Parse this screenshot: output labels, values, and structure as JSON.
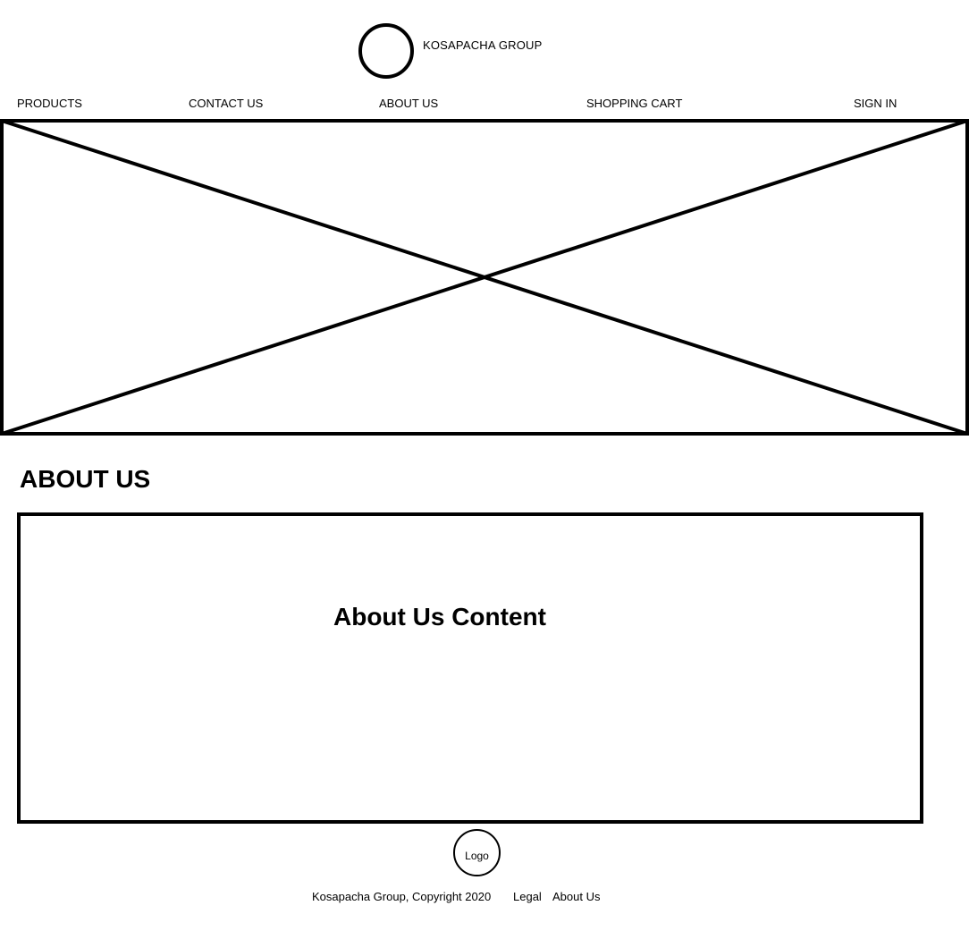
{
  "header": {
    "brand_name": "KOSAPACHA GROUP"
  },
  "nav": {
    "items": [
      {
        "label": "PRODUCTS"
      },
      {
        "label": "CONTACT US"
      },
      {
        "label": "ABOUT US"
      },
      {
        "label": "SHOPPING CART"
      },
      {
        "label": "SIGN IN"
      }
    ]
  },
  "hero": {
    "icon": "image-placeholder-icon"
  },
  "main": {
    "heading": "ABOUT US",
    "content_label": "About Us Content"
  },
  "footer": {
    "logo_label": "Logo",
    "copyright": "Kosapacha Group, Copyright 2020",
    "links": [
      {
        "label": "Legal"
      },
      {
        "label": "About Us"
      }
    ]
  },
  "colors": {
    "stroke": "#000000",
    "background": "#ffffff"
  }
}
